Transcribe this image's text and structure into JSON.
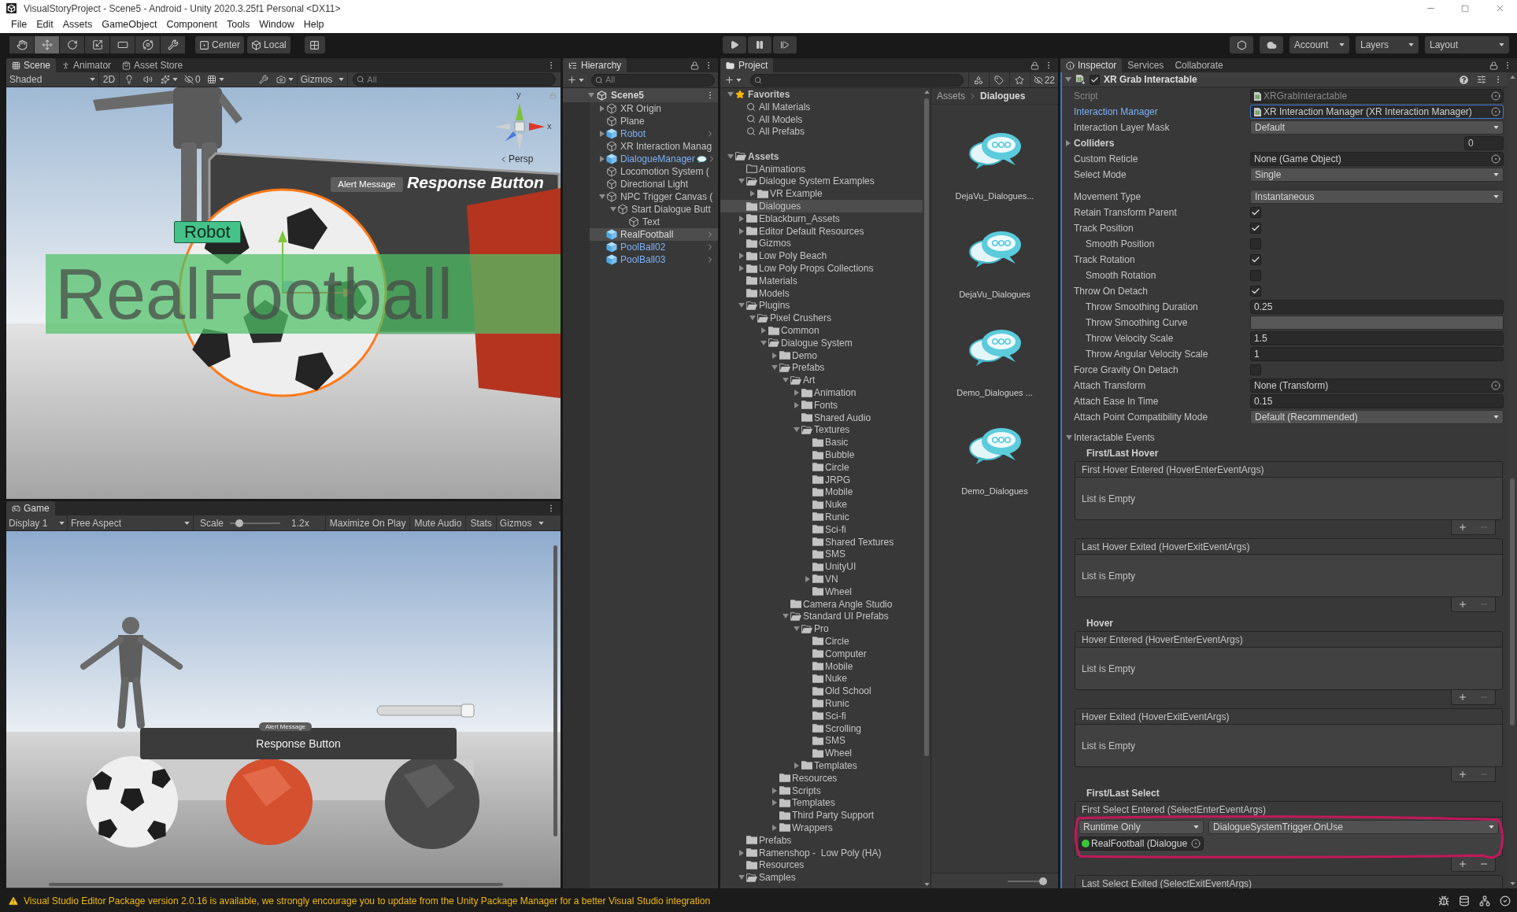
{
  "window": {
    "title": "VisualStoryProject - Scene5 - Android - Unity 2020.3.25f1 Personal <DX11>"
  },
  "menu": [
    "File",
    "Edit",
    "Assets",
    "GameObject",
    "Component",
    "Tools",
    "Window",
    "Help"
  ],
  "toolbar": {
    "tools": [
      {
        "kind": "hand",
        "selected": false
      },
      {
        "kind": "move",
        "selected": true
      },
      {
        "kind": "rotate",
        "selected": false
      },
      {
        "kind": "scale",
        "selected": false
      },
      {
        "kind": "rect",
        "selected": false
      },
      {
        "kind": "transform",
        "selected": false
      },
      {
        "kind": "custom",
        "selected": false
      }
    ],
    "pivot": "Center",
    "space": "Local",
    "account": "Account",
    "layers": "Layers",
    "layout": "Layout"
  },
  "scene_panel": {
    "tabs": [
      {
        "kind": "scene",
        "label": "Scene",
        "selected": true
      },
      {
        "kind": "animator",
        "label": "Animator",
        "selected": false
      },
      {
        "kind": "store",
        "label": "Asset Store",
        "selected": false
      }
    ],
    "shading": "Shaded",
    "mode_2d": "2D",
    "hidden_count": "0",
    "gizmos": "Gizmos",
    "search_placeholder": "All",
    "view": {
      "axis_labels": [
        "y",
        "x"
      ],
      "projection": "Persp",
      "alert_button": "Alert Message",
      "response_text": "Response Button",
      "robot_label": "Robot",
      "world_text": "RealFootball"
    }
  },
  "game_panel": {
    "tabs": [
      {
        "kind": "game",
        "label": "Game",
        "selected": true
      }
    ],
    "display": "Display 1",
    "aspect": "Free Aspect",
    "scale_label": "Scale",
    "scale": {
      "level": 0.12
    },
    "scale_value": "1.2x",
    "toggles": [
      "Maximize On Play",
      "Mute Audio",
      "Stats"
    ],
    "gizmos": "Gizmos",
    "view": {
      "alert_label": "Alert Message",
      "response_text": "Response Button"
    }
  },
  "hierarchy": {
    "title": "Hierarchy",
    "search_placeholder": "All",
    "scene": {
      "name": "Scene5",
      "expanded": true
    },
    "items": [
      {
        "name": "XR Origin",
        "prefab": false,
        "selected": false,
        "expanded": false
      },
      {
        "name": "Plane",
        "prefab": false,
        "selected": false
      },
      {
        "name": "Robot",
        "prefab": true,
        "selected": false,
        "expanded": false
      },
      {
        "name": "XR Interaction Manag",
        "prefab": false,
        "selected": false
      },
      {
        "name": "DialogueManager",
        "prefab": true,
        "selected": false,
        "expanded": false,
        "dialogue_icon": true
      },
      {
        "name": "Locomotion System (",
        "prefab": false,
        "selected": false
      },
      {
        "name": "Directional Light",
        "prefab": false,
        "selected": false
      },
      {
        "name": "NPC Trigger Canvas (",
        "prefab": false,
        "selected": false,
        "expanded": true,
        "children": [
          {
            "name": "Start Dialogue Butt",
            "prefab": false,
            "selected": false,
            "expanded": true,
            "children": [
              {
                "name": "Text",
                "prefab": false,
                "selected": false
              }
            ]
          }
        ]
      },
      {
        "name": "RealFootball",
        "prefab": true,
        "selected": true
      },
      {
        "name": "PoolBall02",
        "prefab": true,
        "selected": false
      },
      {
        "name": "PoolBall03",
        "prefab": true,
        "selected": false
      }
    ]
  },
  "project": {
    "title": "Project",
    "hidden_count": "22",
    "favorites": {
      "label": "Favorites",
      "expanded": true,
      "items": [
        "All Materials",
        "All Models",
        "All Prefabs"
      ]
    },
    "tree": [
      {
        "name": "Assets",
        "expanded": true,
        "selected": false,
        "children": [
          {
            "name": "Animations",
            "selected": false,
            "empty": true
          },
          {
            "name": "Dialogue System Examples",
            "expanded": true,
            "selected": false,
            "children": [
              {
                "name": "VR Example",
                "expanded": false,
                "selected": false
              }
            ]
          },
          {
            "name": "Dialogues",
            "selected": true
          },
          {
            "name": "Eblackburn_Assets",
            "expanded": false,
            "selected": false
          },
          {
            "name": "Editor Default Resources",
            "expanded": false,
            "selected": false
          },
          {
            "name": "Gizmos",
            "selected": false
          },
          {
            "name": "Low Poly Beach",
            "expanded": false,
            "selected": false
          },
          {
            "name": "Low Poly Props Collections",
            "expanded": false,
            "selected": false
          },
          {
            "name": "Materials",
            "selected": false
          },
          {
            "name": "Models",
            "selected": false
          },
          {
            "name": "Plugins",
            "expanded": true,
            "selected": false,
            "children": [
              {
                "name": "Pixel Crushers",
                "expanded": true,
                "selected": false,
                "children": [
                  {
                    "name": "Common",
                    "expanded": false,
                    "selected": false
                  },
                  {
                    "name": "Dialogue System",
                    "expanded": true,
                    "selected": false,
                    "children": [
                      {
                        "name": "Demo",
                        "expanded": false,
                        "selected": false
                      },
                      {
                        "name": "Prefabs",
                        "expanded": true,
                        "selected": false,
                        "children": [
                          {
                            "name": "Art",
                            "expanded": true,
                            "selected": false,
                            "children": [
                              {
                                "name": "Animation",
                                "expanded": false,
                                "selected": false
                              },
                              {
                                "name": "Fonts",
                                "expanded": false,
                                "selected": false
                              },
                              {
                                "name": "Shared Audio",
                                "selected": false
                              },
                              {
                                "name": "Textures",
                                "expanded": true,
                                "selected": false,
                                "children": [
                                  {
                                    "name": "Basic",
                                    "selected": false
                                  },
                                  {
                                    "name": "Bubble",
                                    "selected": false
                                  },
                                  {
                                    "name": "Circle",
                                    "selected": false
                                  },
                                  {
                                    "name": "JRPG",
                                    "selected": false
                                  },
                                  {
                                    "name": "Mobile",
                                    "selected": false
                                  },
                                  {
                                    "name": "Nuke",
                                    "selected": false
                                  },
                                  {
                                    "name": "Runic",
                                    "selected": false
                                  },
                                  {
                                    "name": "Sci-fi",
                                    "selected": false
                                  },
                                  {
                                    "name": "Shared Textures",
                                    "selected": false
                                  },
                                  {
                                    "name": "SMS",
                                    "selected": false
                                  },
                                  {
                                    "name": "UnityUI",
                                    "selected": false
                                  },
                                  {
                                    "name": "VN",
                                    "expanded": false,
                                    "selected": false
                                  },
                                  {
                                    "name": "Wheel",
                                    "selected": false
                                  }
                                ]
                              }
                            ]
                          },
                          {
                            "name": "Camera Angle Studio",
                            "selected": false
                          },
                          {
                            "name": "Standard UI Prefabs",
                            "expanded": true,
                            "selected": false,
                            "children": [
                              {
                                "name": "Pro",
                                "expanded": true,
                                "selected": false,
                                "children": [
                                  {
                                    "name": "Circle",
                                    "selected": false
                                  },
                                  {
                                    "name": "Computer",
                                    "selected": false
                                  },
                                  {
                                    "name": "Mobile",
                                    "selected": false
                                  },
                                  {
                                    "name": "Nuke",
                                    "selected": false
                                  },
                                  {
                                    "name": "Old School",
                                    "selected": false
                                  },
                                  {
                                    "name": "Runic",
                                    "selected": false
                                  },
                                  {
                                    "name": "Sci-fi",
                                    "selected": false
                                  },
                                  {
                                    "name": "Scrolling",
                                    "selected": false
                                  },
                                  {
                                    "name": "SMS",
                                    "selected": false
                                  },
                                  {
                                    "name": "Wheel",
                                    "selected": false
                                  }
                                ]
                              },
                              {
                                "name": "Templates",
                                "expanded": false,
                                "selected": false
                              }
                            ]
                          }
                        ]
                      },
                      {
                        "name": "Resources",
                        "selected": false
                      },
                      {
                        "name": "Scripts",
                        "expanded": false,
                        "selected": false
                      },
                      {
                        "name": "Templates",
                        "expanded": false,
                        "selected": false
                      },
                      {
                        "name": "Third Party Support",
                        "selected": false
                      },
                      {
                        "name": "Wrappers",
                        "expanded": false,
                        "selected": false
                      }
                    ]
                  }
                ]
              }
            ]
          },
          {
            "name": "Prefabs",
            "selected": false
          },
          {
            "name": "Ramenshop -  Low Poly (HA)",
            "expanded": false,
            "selected": false
          },
          {
            "name": "Resources",
            "selected": false
          },
          {
            "name": "Samples",
            "expanded": true,
            "selected": false
          }
        ]
      }
    ],
    "breadcrumb": [
      "Assets",
      "Dialogues"
    ],
    "assets": [
      "DejaVu_Dialogues...",
      "DejaVu_Dialogues",
      "Demo_Dialogues ...",
      "Demo_Dialogues"
    ],
    "icon_size": {
      "level": 1
    }
  },
  "inspector": {
    "tabs": [
      {
        "kind": "inspector",
        "label": "Inspector",
        "selected": true
      },
      {
        "kind": "services",
        "label": "Services",
        "selected": false
      },
      {
        "kind": "collaborate",
        "label": "Collaborate",
        "selected": false
      }
    ],
    "component": {
      "title": "XR Grab Interactable",
      "enabled": true,
      "expanded": true
    },
    "property_groups": [
      [
        {
          "kind": "object",
          "label": "Script",
          "value": "XRGrabInteractable",
          "script_icon": true,
          "disabled": true,
          "focused": false
        },
        {
          "kind": "object",
          "label": "Interaction Manager",
          "value": "XR Interaction Manager (XR Interaction Manager)",
          "script_icon": true,
          "disabled": false,
          "focused": true
        },
        {
          "kind": "dropdown",
          "label": "Interaction Layer Mask",
          "value": "Default"
        },
        {
          "kind": "foldout",
          "label": "Colliders",
          "value": "0",
          "expanded": false
        },
        {
          "kind": "object",
          "label": "Custom Reticle",
          "value": "None (Game Object)",
          "script_icon": false,
          "disabled": false,
          "focused": false
        },
        {
          "kind": "dropdown",
          "label": "Select Mode",
          "value": "Single"
        }
      ],
      [
        {
          "kind": "dropdown",
          "label": "Movement Type",
          "value": "Instantaneous"
        },
        {
          "kind": "checkbox",
          "label": "Retain Transform Parent",
          "checked": true
        },
        {
          "kind": "checkbox",
          "label": "Track Position",
          "checked": true,
          "children": [
            {
              "kind": "checkbox",
              "label": "Smooth Position",
              "checked": false
            }
          ]
        },
        {
          "kind": "checkbox",
          "label": "Track Rotation",
          "checked": true,
          "children": [
            {
              "kind": "checkbox",
              "label": "Smooth Rotation",
              "checked": false
            }
          ]
        },
        {
          "kind": "checkbox",
          "label": "Throw On Detach",
          "checked": true,
          "children": [
            {
              "kind": "number",
              "label": "Throw Smoothing Duration",
              "value": "0.25"
            },
            {
              "kind": "curve",
              "label": "Throw Smoothing Curve"
            },
            {
              "kind": "number",
              "label": "Throw Velocity Scale",
              "value": "1.5"
            },
            {
              "kind": "number",
              "label": "Throw Angular Velocity Scale",
              "value": "1"
            }
          ]
        },
        {
          "kind": "checkbox",
          "label": "Force Gravity On Detach",
          "checked": false
        },
        {
          "kind": "object",
          "label": "Attach Transform",
          "value": "None (Transform)",
          "script_icon": false,
          "disabled": false,
          "focused": false
        },
        {
          "kind": "number",
          "label": "Attach Ease In Time",
          "value": "0.15"
        },
        {
          "kind": "dropdown",
          "label": "Attach Point Compatibility Mode",
          "value": "Default (Recommended)"
        }
      ]
    ],
    "events": {
      "label": "Interactable Events",
      "expanded": true,
      "sections": [
        {
          "heading": "First/Last Hover",
          "events": [
            {
              "name": "First Hover Entered (HoverEnterEventArgs)",
              "empty_text": "List is Empty"
            },
            {
              "name": "Last Hover Exited (HoverExitEventArgs)",
              "empty_text": "List is Empty"
            }
          ]
        },
        {
          "heading": "Hover",
          "events": [
            {
              "name": "Hover Entered (HoverEnterEventArgs)",
              "empty_text": "List is Empty"
            },
            {
              "name": "Hover Exited (HoverExitEventArgs)",
              "empty_text": "List is Empty"
            }
          ]
        },
        {
          "heading": "First/Last Select",
          "events": [
            {
              "name": "First Select Entered (SelectEnterEventArgs)",
              "listeners": [
                {
                  "mode": "Runtime Only",
                  "function": "DialogueSystemTrigger.OnUse",
                  "target": "RealFootball (Dialogue",
                  "annotated": true
                }
              ]
            },
            {
              "name": "Last Select Exited (SelectExitEventArgs)"
            }
          ]
        }
      ]
    }
  },
  "status_bar": {
    "message": "Visual Studio Editor Package version 2.0.16 is available, we strongly encourage you to update from the Unity Package Manager for a better Visual Studio integration"
  }
}
